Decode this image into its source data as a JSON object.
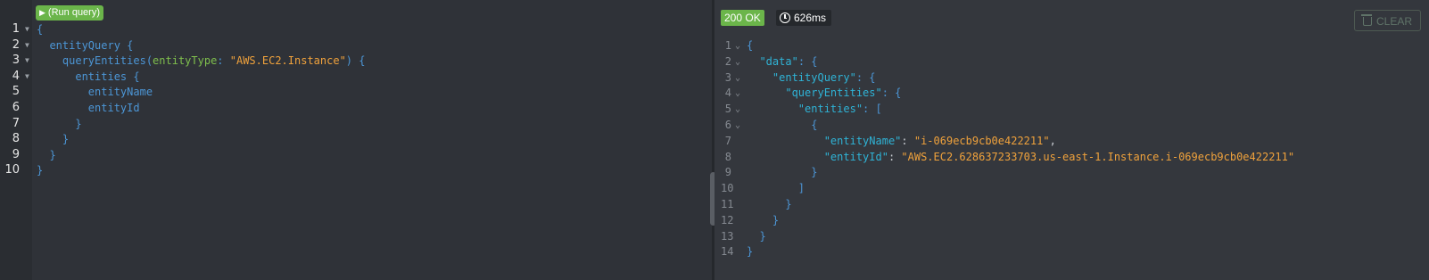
{
  "query_editor": {
    "run_button_label": "(Run query)",
    "lines": [
      {
        "number": "1",
        "fold": "▼",
        "tokens": [
          {
            "t": "{",
            "c": "pb"
          }
        ]
      },
      {
        "number": "2",
        "fold": "▼",
        "tokens": [
          {
            "t": "  entityQuery {",
            "c": "pb"
          }
        ]
      },
      {
        "number": "3",
        "fold": "▼",
        "tokens": [
          {
            "t": "    queryEntities(",
            "c": "pb"
          },
          {
            "t": "entityType",
            "c": "pa"
          },
          {
            "t": ": ",
            "c": "pb"
          },
          {
            "t": "\"AWS.EC2.Instance\"",
            "c": "ps"
          },
          {
            "t": ") {",
            "c": "pb"
          }
        ]
      },
      {
        "number": "4",
        "fold": "▼",
        "tokens": [
          {
            "t": "      entities {",
            "c": "pb"
          }
        ]
      },
      {
        "number": "5",
        "fold": "",
        "tokens": [
          {
            "t": "        entityName",
            "c": "pb"
          }
        ]
      },
      {
        "number": "6",
        "fold": "",
        "tokens": [
          {
            "t": "        entityId",
            "c": "pb"
          }
        ]
      },
      {
        "number": "7",
        "fold": "",
        "tokens": [
          {
            "t": "      }",
            "c": "pb"
          }
        ]
      },
      {
        "number": "8",
        "fold": "",
        "tokens": [
          {
            "t": "    }",
            "c": "pb"
          }
        ]
      },
      {
        "number": "9",
        "fold": "",
        "tokens": [
          {
            "t": "  }",
            "c": "pb"
          }
        ]
      },
      {
        "number": "10",
        "fold": "",
        "tokens": [
          {
            "t": "}",
            "c": "pb"
          }
        ]
      }
    ]
  },
  "response": {
    "status": "200 OK",
    "time": "626ms",
    "clear_label": "CLEAR",
    "lines": [
      {
        "number": "1",
        "fold": "⌄",
        "tokens": [
          {
            "t": "{",
            "c": "pb"
          }
        ]
      },
      {
        "number": "2",
        "fold": "⌄",
        "tokens": [
          {
            "t": "  ",
            "c": "pb"
          },
          {
            "t": "\"data\"",
            "c": "pk"
          },
          {
            "t": ": {",
            "c": "pb"
          }
        ]
      },
      {
        "number": "3",
        "fold": "⌄",
        "tokens": [
          {
            "t": "    ",
            "c": "pb"
          },
          {
            "t": "\"entityQuery\"",
            "c": "pk"
          },
          {
            "t": ": {",
            "c": "pb"
          }
        ]
      },
      {
        "number": "4",
        "fold": "⌄",
        "tokens": [
          {
            "t": "      ",
            "c": "pb"
          },
          {
            "t": "\"queryEntities\"",
            "c": "pk"
          },
          {
            "t": ": {",
            "c": "pb"
          }
        ]
      },
      {
        "number": "5",
        "fold": "⌄",
        "tokens": [
          {
            "t": "        ",
            "c": "pb"
          },
          {
            "t": "\"entities\"",
            "c": "pk"
          },
          {
            "t": ": [",
            "c": "pb"
          }
        ]
      },
      {
        "number": "6",
        "fold": "⌄",
        "tokens": [
          {
            "t": "          {",
            "c": "pb"
          }
        ]
      },
      {
        "number": "7",
        "fold": "",
        "tokens": [
          {
            "t": "            ",
            "c": "pb"
          },
          {
            "t": "\"entityName\"",
            "c": "pk"
          },
          {
            "t": ": ",
            "c": "pw"
          },
          {
            "t": "\"i-069ecb9cb0e422211\"",
            "c": "ps"
          },
          {
            "t": ",",
            "c": "pw"
          }
        ]
      },
      {
        "number": "8",
        "fold": "",
        "tokens": [
          {
            "t": "            ",
            "c": "pb"
          },
          {
            "t": "\"entityId\"",
            "c": "pk"
          },
          {
            "t": ": ",
            "c": "pw"
          },
          {
            "t": "\"AWS.EC2.628637233703.us-east-1.Instance.i-069ecb9cb0e422211\"",
            "c": "ps"
          }
        ]
      },
      {
        "number": "9",
        "fold": "",
        "tokens": [
          {
            "t": "          }",
            "c": "pb"
          }
        ]
      },
      {
        "number": "10",
        "fold": "",
        "tokens": [
          {
            "t": "        ]",
            "c": "pb"
          }
        ]
      },
      {
        "number": "11",
        "fold": "",
        "tokens": [
          {
            "t": "      }",
            "c": "pb"
          }
        ]
      },
      {
        "number": "12",
        "fold": "",
        "tokens": [
          {
            "t": "    }",
            "c": "pb"
          }
        ]
      },
      {
        "number": "13",
        "fold": "",
        "tokens": [
          {
            "t": "  }",
            "c": "pb"
          }
        ]
      },
      {
        "number": "14",
        "fold": "",
        "tokens": [
          {
            "t": "}",
            "c": "pb"
          }
        ]
      }
    ]
  },
  "colors": {
    "accent_green": "#6bb54a",
    "punctuation_blue": "#4c96d6",
    "key_cyan": "#2fb3d6",
    "argument_green": "#7fbf4d",
    "string_orange": "#f0a23c"
  },
  "icons": {
    "run": "play-icon",
    "time": "clock-icon",
    "clear": "trash-icon"
  }
}
